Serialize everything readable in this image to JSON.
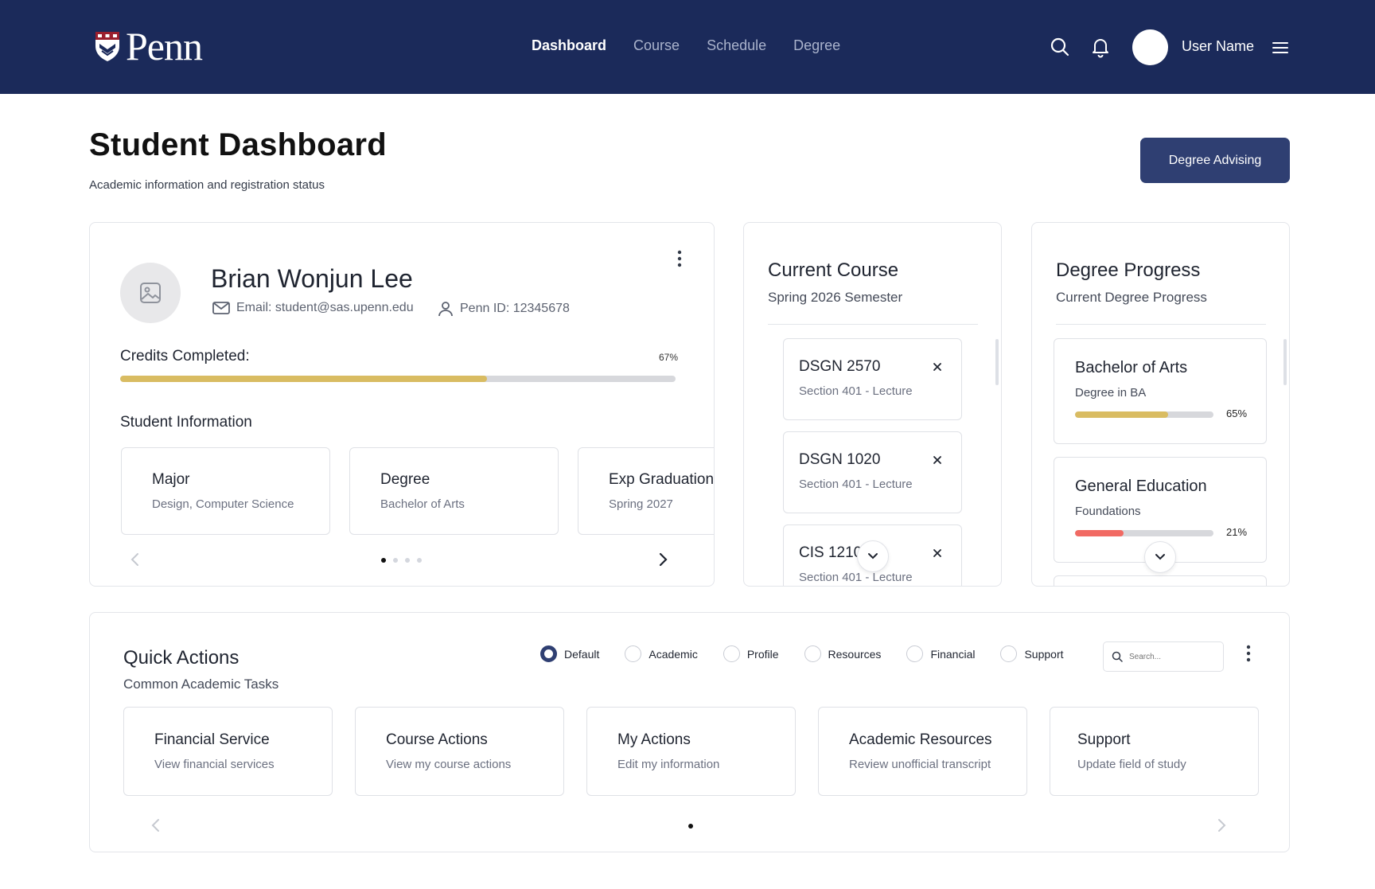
{
  "header": {
    "logo_text": "Penn",
    "nav": [
      {
        "label": "Dashboard",
        "active": true
      },
      {
        "label": "Course",
        "active": false
      },
      {
        "label": "Schedule",
        "active": false
      },
      {
        "label": "Degree",
        "active": false
      }
    ],
    "icons": [
      "search-icon",
      "bell-icon",
      "menu-icon"
    ],
    "user_name": "User Name"
  },
  "page": {
    "title": "Student Dashboard",
    "subtitle": "Academic information and registration status",
    "advising_button": "Degree Advising"
  },
  "profile": {
    "name": "Brian Wonjun Lee",
    "email": "Email: student@sas.upenn.edu",
    "penn_id": "Penn ID: 12345678",
    "credits_label": "Credits Completed:",
    "credits_pct_text": "67%",
    "credits_fraction": 0.66,
    "section_label": "Student Information",
    "tiles": [
      {
        "title": "Major",
        "value": "Design, Computer Science"
      },
      {
        "title": "Degree",
        "value": "Bachelor of Arts"
      },
      {
        "title": "Exp Graduation",
        "value": "Spring 2027"
      }
    ],
    "pager": {
      "count": 4,
      "active": 0
    }
  },
  "current_course": {
    "title": "Current Course",
    "subtitle": "Spring 2026 Semester",
    "courses": [
      {
        "code": "DSGN 2570",
        "section": "Section 401 - Lecture"
      },
      {
        "code": "DSGN 1020",
        "section": "Section 401 - Lecture"
      },
      {
        "code": "CIS 1210",
        "section": "Section 401 - Lecture"
      }
    ]
  },
  "degree_progress": {
    "title": "Degree Progress",
    "subtitle": "Current Degree Progress",
    "items": [
      {
        "title": "Bachelor of Arts",
        "sub": "Degree in BA",
        "pct_text": "65%",
        "fraction": 0.67
      },
      {
        "title": "General Education",
        "sub": "Foundations",
        "pct_text": "21%",
        "fraction": 0.35
      }
    ]
  },
  "quick_actions": {
    "title": "Quick Actions",
    "subtitle": "Common Academic Tasks",
    "filters": [
      {
        "label": "Default",
        "selected": true
      },
      {
        "label": "Academic",
        "selected": false
      },
      {
        "label": "Profile",
        "selected": false
      },
      {
        "label": "Resources",
        "selected": false
      },
      {
        "label": "Financial",
        "selected": false
      },
      {
        "label": "Support",
        "selected": false
      }
    ],
    "search_placeholder": "Search...",
    "tiles": [
      {
        "title": "Financial Service",
        "sub": "View financial services"
      },
      {
        "title": "Course Actions",
        "sub": "View my course actions"
      },
      {
        "title": "My Actions",
        "sub": "Edit my information"
      },
      {
        "title": "Academic Resources",
        "sub": "Review unofficial transcript"
      },
      {
        "title": "Support",
        "sub": "Update field of study"
      }
    ],
    "pager": {
      "count": 1,
      "active": 0
    }
  },
  "colors": {
    "nav_bg": "#1b2a5a",
    "button_bg": "#2f3f72",
    "progress_gold": "#d9bc62",
    "progress_red": "#f16a63",
    "track": "#d7d8dc"
  }
}
